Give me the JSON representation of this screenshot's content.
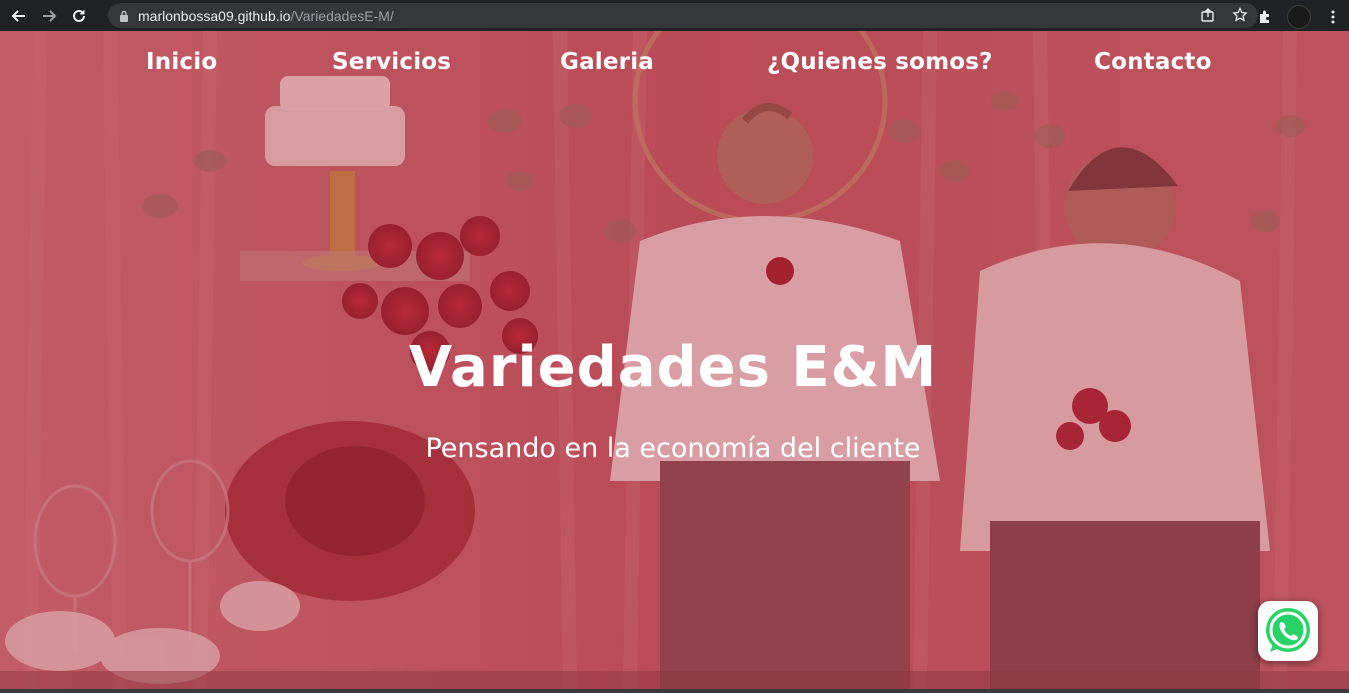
{
  "browser": {
    "url_host": "marlonbossa09.github.io",
    "url_path": "/VariedadesE-M/",
    "icons": [
      "back-arrow-icon",
      "forward-arrow-icon",
      "reload-icon",
      "lock-icon",
      "share-icon",
      "star-icon",
      "extensions-icon",
      "profile-avatar",
      "more-menu-icon"
    ]
  },
  "nav": {
    "items": [
      {
        "label": "Inicio"
      },
      {
        "label": "Servicios"
      },
      {
        "label": "Galeria"
      },
      {
        "label": "¿Quienes somos?"
      },
      {
        "label": "Contacto"
      }
    ]
  },
  "hero": {
    "title": "Variedades E&M",
    "subtitle": "Pensando en la economía del cliente",
    "overlay_color": "#b4505a"
  },
  "whatsapp": {
    "icon": "whatsapp-icon",
    "color": "#25d366"
  }
}
